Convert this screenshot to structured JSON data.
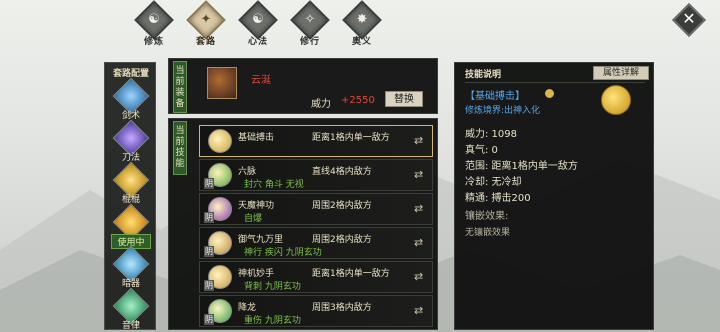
{
  "nav": {
    "items": [
      {
        "label": "修炼",
        "icon": "cultivate-icon",
        "active": false
      },
      {
        "label": "套路",
        "icon": "routine-icon",
        "active": true
      },
      {
        "label": "心法",
        "icon": "mind-method-icon",
        "active": false
      },
      {
        "label": "修行",
        "icon": "practice-icon",
        "active": false
      },
      {
        "label": "奥义",
        "icon": "mystery-icon",
        "active": false
      }
    ]
  },
  "sidebar": {
    "title": "套路配置",
    "items": [
      {
        "label": "剑术",
        "icon": "sword-icon",
        "active": false
      },
      {
        "label": "刀法",
        "icon": "blade-icon",
        "active": false
      },
      {
        "label": "棍棍",
        "icon": "staff-icon",
        "active": false
      },
      {
        "label": "使用中",
        "icon": "fan-icon",
        "active": true
      },
      {
        "label": "暗器",
        "icon": "hidden-weapon-icon",
        "active": false
      },
      {
        "label": "音律",
        "icon": "music-icon",
        "active": false
      }
    ]
  },
  "equipment": {
    "tab_label": "当前装备",
    "name": "云涎",
    "power_label": "威力",
    "power_value": "+2550",
    "swap_label": "替换"
  },
  "skills": {
    "tab_label": "当前技能",
    "rows": [
      {
        "name": "基础搏击",
        "range": "距离1格内单一敌方",
        "tags": "",
        "badge": "",
        "icon_color": "#c8a033",
        "selected": true
      },
      {
        "name": "六脉",
        "range": "直线4格内敌方",
        "tags": "封穴 角斗 无视",
        "badge": "阴",
        "icon_color": "#5aa63a",
        "selected": false
      },
      {
        "name": "天魔神功",
        "range": "周围2格内敌方",
        "tags": "自爆",
        "badge": "阴",
        "icon_color": "#8a3fb0",
        "selected": false
      },
      {
        "name": "御气九万里",
        "range": "周围2格内敌方",
        "tags": "神行 疾闪 九阴玄功",
        "badge": "阴",
        "icon_color": "#b88a44",
        "selected": false
      },
      {
        "name": "神机妙手",
        "range": "距离1格内单一敌方",
        "tags": "背刺 九阴玄功",
        "badge": "阴",
        "icon_color": "#c89944",
        "selected": false
      },
      {
        "name": "降龙",
        "range": "周围3格内敌方",
        "tags": "重伤 九阴玄功",
        "badge": "阴",
        "icon_color": "#3aa04a",
        "selected": false
      }
    ]
  },
  "description": {
    "title": "技能说明",
    "attr_button": "属性详解",
    "skill_name": "【基础搏击】",
    "realm_label": "修炼境界:",
    "realm_value": "出神入化",
    "power": "威力: 1098",
    "qi": "真气: 0",
    "range": "范围: 距离1格内单一敌方",
    "cooldown": "冷却: 无冷却",
    "mastery": "精通: 搏击200",
    "inlay_title": "镶嵌效果:",
    "inlay_value": "无镶嵌效果"
  },
  "colors": {
    "accent_green": "#2e5a2b",
    "power_red": "#e2463a",
    "skill_blue": "#5aa6e8",
    "tag_green": "#7ec24a"
  }
}
